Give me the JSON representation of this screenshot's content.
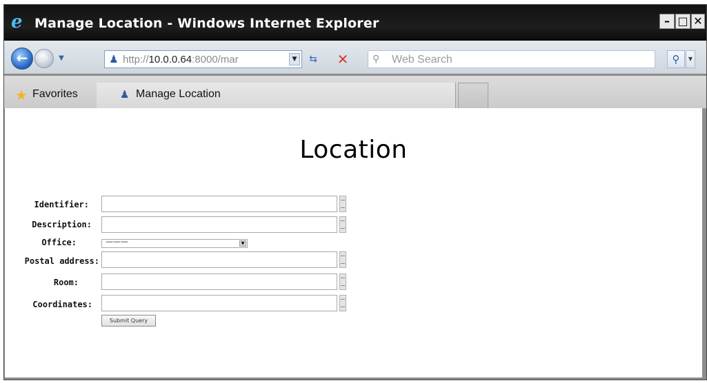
{
  "window": {
    "title": "Manage Location - Windows Internet Explorer",
    "minimize_glyph": "–",
    "maximize_glyph": "□",
    "close_glyph": "✕"
  },
  "toolbar": {
    "url_prefix": "http://",
    "url_host": "10.0.0.64",
    "url_rest": ":8000/mar",
    "search_placeholder": "Web Search"
  },
  "favorites": {
    "label": "Favorites"
  },
  "tab": {
    "label": "Manage Location"
  },
  "page": {
    "title": "Location"
  },
  "form": {
    "identifier_label": "Identifier:",
    "description_label": "Description:",
    "office_label": "Office:",
    "office_value": "———",
    "postal_label": "Postal address:",
    "room_label": "Room:",
    "coordinates_label": "Coordinates:",
    "submit_label": "Submit Query"
  },
  "icons": {
    "ie_logo": "ie-logo-icon",
    "back": "back-arrow-icon",
    "forward": "forward-arrow-icon",
    "refresh": "refresh-icon",
    "stop": "stop-icon",
    "search": "search-icon",
    "favorites_star": "star-icon",
    "page_icon": "page-icon"
  }
}
